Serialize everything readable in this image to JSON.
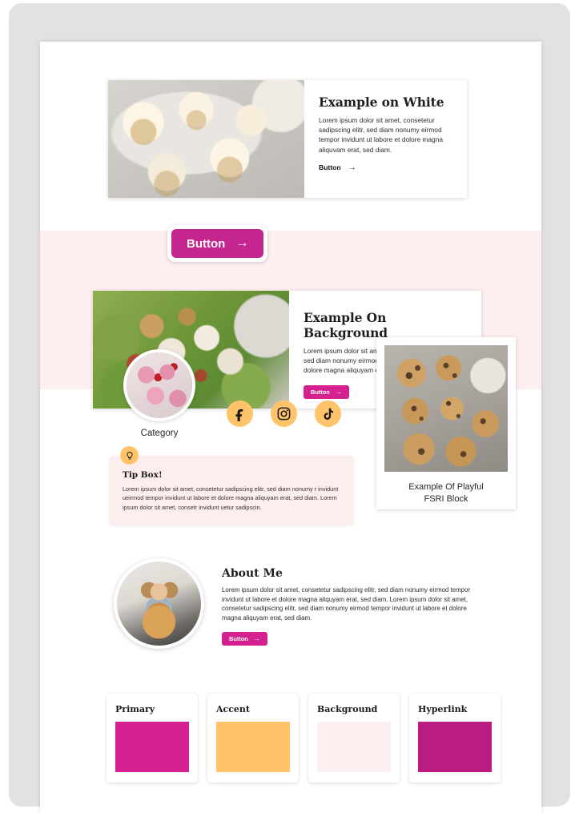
{
  "brand_colors": {
    "primary": "#d5218f",
    "primary_deep": "#c5258f",
    "accent": "#ffc46a",
    "background": "#fdeef0",
    "hyperlink": "#bc1b7f",
    "frame": "#e2e2e2",
    "text": "#2e2c2b"
  },
  "card_white": {
    "title": "Example on White",
    "body": "Lorem ipsum dolor sit amet, consetetur sadipscing elitr, sed diam nonumy eirmod tempor invidunt ut labore et dolore magna aliquvam erat, sed diam.",
    "link_label": "Button",
    "arrow": "→",
    "image_alt": "vanilla-cupcakes-photo"
  },
  "floating_button": {
    "label": "Button",
    "arrow": "→"
  },
  "card_background": {
    "title": "Example On Background",
    "body": "Lorem ipsum dolor sit amet, consetetur sadipscing elitr, sed diam nonumy eirmod tempor invidunt ut labore et dolore magna aliquyam erat, sed diam.",
    "button_label": "Button",
    "arrow": "→",
    "image_alt": "chicken-salad-photo"
  },
  "category": {
    "label": "Category",
    "image_alt": "pink-strawberry-cupcakes-photo"
  },
  "socials": [
    {
      "name": "facebook",
      "glyph": "f"
    },
    {
      "name": "instagram",
      "glyph": ""
    },
    {
      "name": "tiktok",
      "glyph": ""
    }
  ],
  "tip_box": {
    "icon": "lightbulb-icon",
    "title": "Tip Box!",
    "body": "Lorem ipsum dolor sit amet, consetetur sadipscing elitr, sed diam nonumy r invidunt ueirmod tempor invidunt ut labore et dolore magna aliquyam erat, sed diam. Lorem ipsum dolor sit amet, consetr invidunt uetur sadipscin."
  },
  "fsri_block": {
    "caption_line1": "Example Of Playful",
    "caption_line2": "FSRI Block",
    "image_alt": "chocolate-chip-cookies-photo"
  },
  "about": {
    "title": "About Me",
    "body": "Lorem ipsum dolor sit amet, consetetur sadipscing elitr, sed diam nonumy eirmod tempor invidunt ut labore et dolore magna aliquyam erat, sed diam. Lorem ipsum dolor sit amet, consetetur sadipscing elitr, sed diam nonumy eirmod tempor invidunt ut labore et dolore magna aliquyam erat, sed diam.",
    "button_label": "Button",
    "arrow": "→",
    "image_alt": "woman-with-pancakes-photo"
  },
  "swatches": [
    {
      "label": "Primary",
      "hex": "#d5218f"
    },
    {
      "label": "Accent",
      "hex": "#ffc46a"
    },
    {
      "label": "Background",
      "hex": "#fdeef0"
    },
    {
      "label": "Hyperlink",
      "hex": "#bc1b7f"
    }
  ]
}
